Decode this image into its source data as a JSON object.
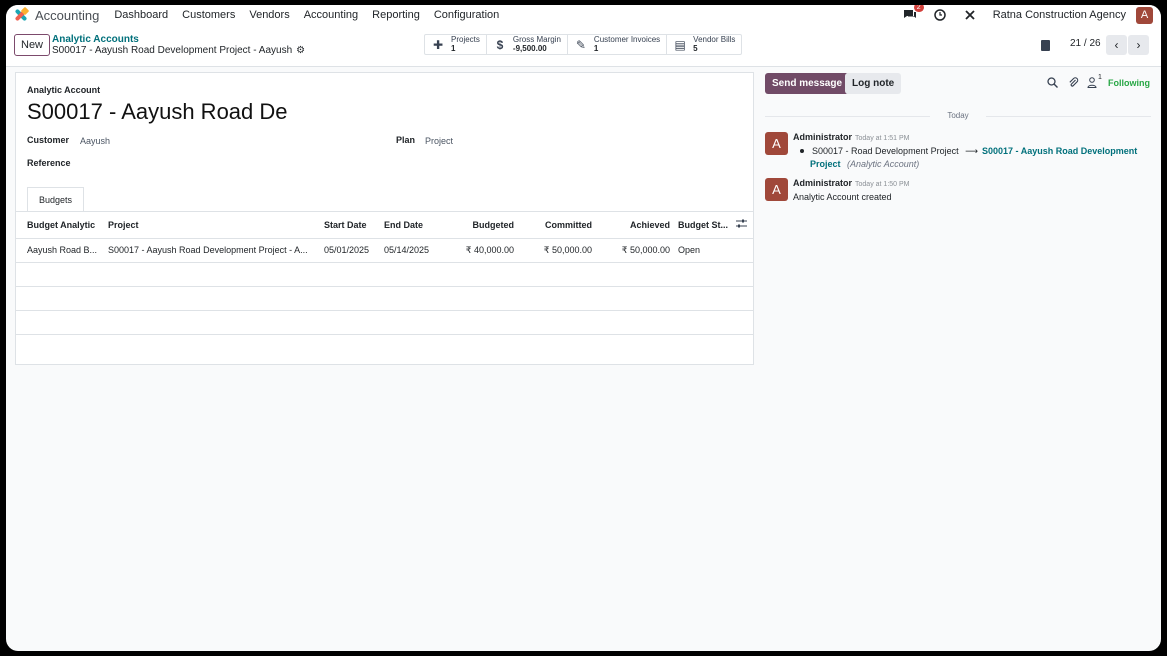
{
  "nav": {
    "app_name": "Accounting",
    "menu": [
      "Dashboard",
      "Customers",
      "Vendors",
      "Accounting",
      "Reporting",
      "Configuration"
    ],
    "messages_badge": "2",
    "company": "Ratna Construction Agency",
    "user_initial": "A"
  },
  "control": {
    "new_label": "New",
    "breadcrumb_parent": "Analytic Accounts",
    "breadcrumb_current": "S00017 - Aayush Road Development Project - Aayush",
    "smart_buttons": [
      {
        "label": "Projects",
        "value": "1",
        "icon": "puzzle-icon"
      },
      {
        "label": "Gross Margin",
        "value": "-9,500.00",
        "icon": "dollar-icon"
      },
      {
        "label": "Customer Invoices",
        "value": "1",
        "icon": "edit-icon"
      },
      {
        "label": "Vendor Bills",
        "value": "5",
        "icon": "file-icon"
      }
    ],
    "pager": "21 / 26"
  },
  "form": {
    "header_label": "Analytic Account",
    "title": "S00017 - Aayush Road De",
    "customer_label": "Customer",
    "customer_value": "Aayush",
    "plan_label": "Plan",
    "plan_value": "Project",
    "reference_label": "Reference",
    "tab": "Budgets",
    "columns": [
      "Budget Analytic",
      "Project",
      "Start Date",
      "End Date",
      "Budgeted",
      "Committed",
      "Achieved",
      "Budget St..."
    ],
    "rows": [
      [
        "Aayush Road B...",
        "S00017 - Aayush Road Development Project - A...",
        "05/01/2025",
        "05/14/2025",
        "₹ 40,000.00",
        "₹ 50,000.00",
        "₹ 50,000.00",
        "Open"
      ]
    ]
  },
  "chatter": {
    "send_label": "Send message",
    "log_label": "Log note",
    "follower_count": "1",
    "following_label": "Following",
    "day_label": "Today",
    "messages": [
      {
        "author": "Administrator",
        "time": "Today at 1:51 PM",
        "old_value": "S00017 - Road Development Project",
        "new_value": "S00017 - Aayush Road Development Project",
        "field": "(Analytic Account)"
      },
      {
        "author": "Administrator",
        "time": "Today at 1:50 PM",
        "text": "Analytic Account created"
      }
    ]
  }
}
